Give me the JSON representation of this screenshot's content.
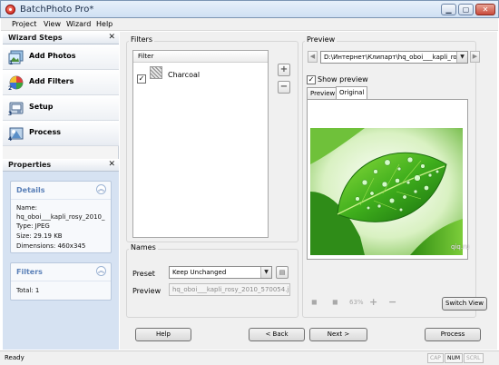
{
  "window": {
    "title": "BatchPhoto Pro*"
  },
  "menu": [
    "Project",
    "View",
    "Wizard",
    "Help"
  ],
  "wizard_steps": {
    "header": "Wizard Steps",
    "items": [
      {
        "label": "Add Photos",
        "icon": "add-photos-icon"
      },
      {
        "label": "Add Filters",
        "icon": "add-filters-icon"
      },
      {
        "label": "Setup",
        "icon": "setup-icon"
      },
      {
        "label": "Process",
        "icon": "process-icon"
      }
    ]
  },
  "properties": {
    "header": "Properties",
    "details": {
      "title": "Details",
      "name_label": "Name:",
      "name_value": "hq_oboi___kapli_rosy_2010_",
      "type": "Type: JPEG",
      "size": "Size: 29.19 KB",
      "dimensions": "Dimensions: 460x345"
    },
    "filters": {
      "title": "Filters",
      "total": "Total: 1"
    }
  },
  "filters_group": {
    "label": "Filters",
    "column_header": "Filter",
    "items": [
      {
        "name": "Charcoal",
        "checked": true
      }
    ],
    "add_symbol": "+",
    "remove_symbol": "−"
  },
  "names_group": {
    "label": "Names",
    "preset_label": "Preset",
    "preset_value": "Keep Unchanged",
    "preview_label": "Preview",
    "preview_value": "hq_oboi___kapli_rosy_2010_570054.jp"
  },
  "preview_group": {
    "label": "Preview",
    "path": "D:\\Интернет\\Клипарт\\hq_oboi___kapli_ro",
    "show_preview_label": "Show preview",
    "show_preview_checked": true,
    "tabs": [
      "Preview",
      "Original"
    ],
    "active_tab": "Original",
    "watermark": "qiq.ru",
    "zoom": "63%",
    "switch_view_label": "Switch View"
  },
  "buttons": {
    "help": "Help",
    "back": "< Back",
    "next": "Next >",
    "process": "Process"
  },
  "status": {
    "text": "Ready",
    "indicators": [
      {
        "label": "CAP",
        "on": false
      },
      {
        "label": "NUM",
        "on": true
      },
      {
        "label": "SCRL",
        "on": false
      }
    ]
  }
}
